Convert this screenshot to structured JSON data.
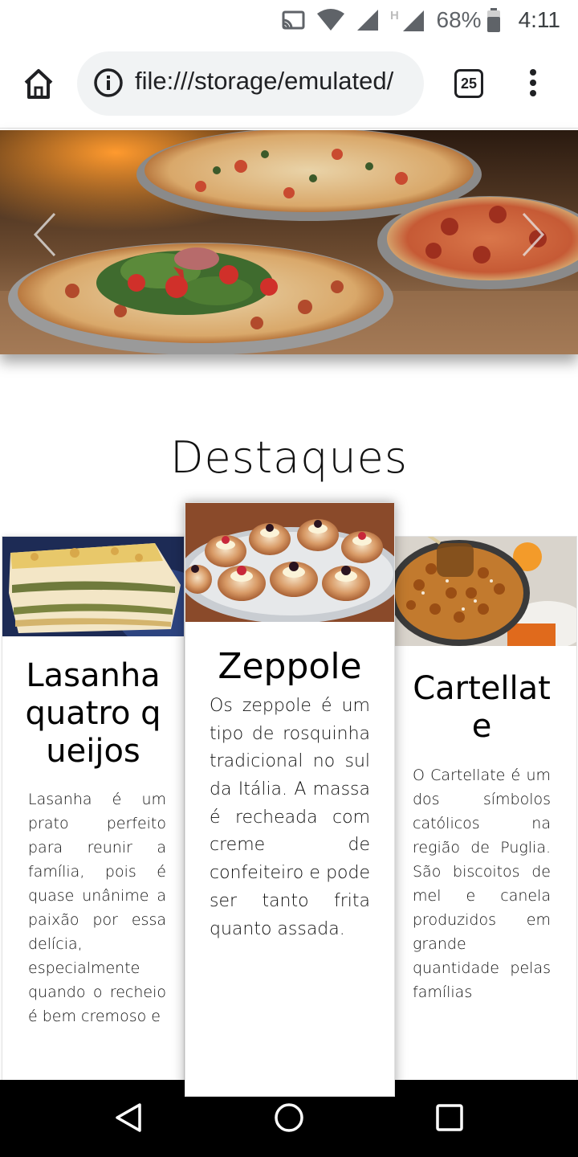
{
  "status_bar": {
    "icons": [
      "cast-icon",
      "wifi-icon",
      "signal-icon",
      "h-signal-icon",
      "battery-icon"
    ],
    "battery": "68%",
    "time": "4:11"
  },
  "browser": {
    "url": "file:///storage/emulated/",
    "tab_count": "25",
    "icons": [
      "home-icon",
      "info-icon",
      "tabs-icon",
      "more-vert-icon"
    ]
  },
  "hero": {
    "image": "pizzas-on-stands",
    "prev_icon": "chevron-left-icon",
    "next_icon": "chevron-right-icon"
  },
  "section": {
    "title": "Destaques"
  },
  "cards": [
    {
      "image": "lasagna-photo",
      "title": "Lasanha quatro queijos",
      "text": "Lasanha é um prato perfeito para reunir a família, pois é quase unânime a paixão por essa delícia, especialmente quando o recheio é bem cremoso e"
    },
    {
      "image": "zeppole-photo",
      "title": "Zeppole",
      "text": "Os zeppole é um tipo de rosquinha tradicional no sul da Itália. A massa é recheada com creme de confeiteiro e pode ser tanto frita quanto assada."
    },
    {
      "image": "cartellate-photo",
      "title": "Cartellate",
      "text": "O Cartellate é um dos símbolos católicos na região de Puglia. São biscoitos de mel e canela produzidos em grande quantidade pelas famílias"
    }
  ],
  "nav_bar": {
    "icons": [
      "back-icon",
      "home-circle-icon",
      "recents-icon"
    ]
  },
  "colors": {
    "statusbar_icons": "#5f6368",
    "urlbar_bg": "#f1f3f4",
    "text": "#111111"
  }
}
